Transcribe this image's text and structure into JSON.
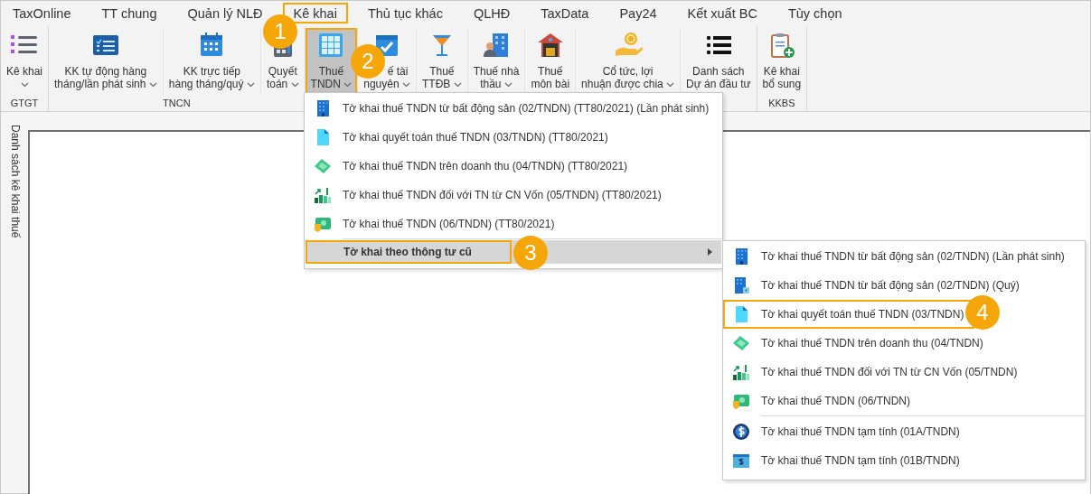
{
  "tabs": [
    {
      "label": "TaxOnline"
    },
    {
      "label": "TT chung"
    },
    {
      "label": "Quản lý NLĐ"
    },
    {
      "label": "Kê khai",
      "callout": "1"
    },
    {
      "label": "Thủ tục khác"
    },
    {
      "label": "QLHĐ"
    },
    {
      "label": "TaxData"
    },
    {
      "label": "Pay24"
    },
    {
      "label": "Kết xuất BC"
    },
    {
      "label": "Tùy chọn"
    }
  ],
  "ribbon": {
    "groups": [
      {
        "label": "GTGT",
        "buttons": [
          {
            "lines": [
              "Kê khai"
            ],
            "dropdown": true,
            "selected": false
          }
        ]
      },
      {
        "label": "TNCN",
        "buttons": [
          {
            "lines": [
              "KK tự động hàng",
              "tháng/lần phát sinh"
            ],
            "dropdown": true,
            "selected": false
          },
          {
            "lines": [
              "KK trực tiếp",
              "hàng tháng/quý"
            ],
            "dropdown": true,
            "selected": false
          },
          {
            "lines": [
              "Quyết",
              "toán"
            ],
            "dropdown": true,
            "selected": false
          }
        ]
      },
      {
        "buttons": [
          {
            "lines": [
              "Thuế",
              "TNDN"
            ],
            "dropdown": true,
            "selected": true,
            "callout": "2"
          },
          {
            "lines": [
              "ế tài",
              "nguyên"
            ],
            "dropdown": true,
            "selected": false
          },
          {
            "lines": [
              "Thuế",
              "TTĐB"
            ],
            "dropdown": true,
            "selected": false
          },
          {
            "lines": [
              "Thuế nhà",
              "thầu"
            ],
            "dropdown": true,
            "selected": false
          },
          {
            "lines": [
              "Thuế",
              "môn bài"
            ],
            "dropdown": false,
            "selected": false
          },
          {
            "lines": [
              "Cổ tức, lợi",
              "nhuận được chia"
            ],
            "dropdown": true,
            "selected": false
          },
          {
            "lines": [
              "Danh sách",
              "Dự án đầu tư"
            ],
            "dropdown": false,
            "selected": false
          }
        ]
      },
      {
        "label": "KKBS",
        "buttons": [
          {
            "lines": [
              "Kê khai",
              "bổ sung"
            ],
            "dropdown": false,
            "selected": false
          }
        ]
      }
    ]
  },
  "side_panel": {
    "title": "Danh sách kê khai thuế"
  },
  "menu": {
    "sections": [
      {
        "items": [
          {
            "kind": "item",
            "label": "Tờ khai thuế TNDN từ bất động sản (02/TNDN) (TT80/2021) (Lần phát sinh)",
            "highlighted": false
          },
          {
            "kind": "item",
            "label": "Tờ khai quyết toán thuế TNDN (03/TNDN) (TT80/2021)",
            "highlighted": false
          },
          {
            "kind": "item",
            "label": "Tờ khai thuế TNDN trên doanh thu (04/TNDN) (TT80/2021)",
            "highlighted": false
          },
          {
            "kind": "item",
            "label": "Tờ khai thuế TNDN đối với TN từ CN Vốn (05/TNDN) (TT80/2021)",
            "highlighted": false
          },
          {
            "kind": "item",
            "label": "Tờ khai thuế TNDN (06/TNDN) (TT80/2021)",
            "highlighted": false
          }
        ]
      },
      {
        "items": [
          {
            "kind": "submenu",
            "label": "Tờ khai theo thông tư cũ",
            "highlighted": true,
            "callout": "3"
          }
        ]
      }
    ]
  },
  "submenu": {
    "sections": [
      {
        "items": [
          {
            "kind": "item",
            "label": "Tờ khai thuế TNDN từ bất động sản (02/TNDN) (Lần phát sinh)",
            "highlighted": false
          },
          {
            "kind": "item",
            "label": "Tờ khai thuế TNDN từ bất động sản (02/TNDN) (Quý)",
            "highlighted": false
          },
          {
            "kind": "item",
            "label": "Tờ khai quyết toán thuế TNDN (03/TNDN)",
            "highlighted": false,
            "callout": "4"
          },
          {
            "kind": "item",
            "label": "Tờ khai thuế TNDN trên doanh thu (04/TNDN)",
            "highlighted": false
          },
          {
            "kind": "item",
            "label": "Tờ khai thuế TNDN đối với TN từ CN Vốn (05/TNDN)",
            "highlighted": false
          },
          {
            "kind": "item",
            "label": "Tờ khai thuế TNDN (06/TNDN)",
            "highlighted": false
          }
        ]
      },
      {
        "items": [
          {
            "kind": "item",
            "label": "Tờ khai thuế TNDN tạm tính (01A/TNDN)",
            "highlighted": false
          },
          {
            "kind": "item",
            "label": "Tờ khai thuế TNDN tạm tính (01B/TNDN)",
            "highlighted": false
          }
        ]
      }
    ]
  }
}
